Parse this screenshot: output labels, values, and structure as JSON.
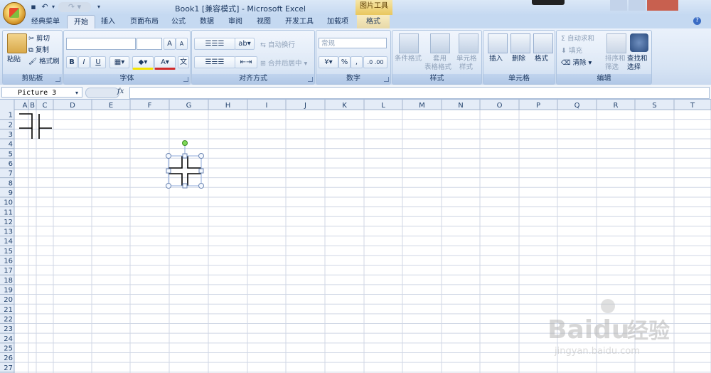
{
  "titlebar": {
    "document_title": "Book1  [兼容模式] - Microsoft Excel",
    "context_title": "图片工具"
  },
  "tabs": [
    "经典菜单",
    "开始",
    "插入",
    "页面布局",
    "公式",
    "数据",
    "审阅",
    "视图",
    "开发工具",
    "加载项",
    "格式"
  ],
  "active_tab": "开始",
  "ribbon": {
    "clipboard": {
      "paste": "粘贴",
      "cut": "剪切",
      "copy": "复制",
      "format_painter": "格式刷",
      "label": "剪贴板"
    },
    "font": {
      "label": "字体",
      "bold": "B",
      "italic": "I",
      "underline": "U",
      "grow": "A",
      "shrink": "A"
    },
    "alignment": {
      "wrap": "自动换行",
      "merge": "合并后居中",
      "label": "对齐方式"
    },
    "number": {
      "format": "常规",
      "percent": "%",
      "comma": ",",
      "label": "数字"
    },
    "styles": {
      "conditional": "条件格式",
      "table_line1": "套用",
      "table_line2": "表格格式",
      "cell_line1": "单元格",
      "cell_line2": "样式",
      "label": "样式"
    },
    "cells": {
      "insert": "插入",
      "delete": "删除",
      "format": "格式",
      "label": "单元格"
    },
    "editing": {
      "autosum": "自动求和",
      "fill": "填充",
      "clear": "清除",
      "sort_line1": "排序和",
      "sort_line2": "筛选",
      "find_line1": "查找和",
      "find_line2": "选择",
      "label": "编辑"
    }
  },
  "formula_bar": {
    "name_box": "Picture 3",
    "fx": "fx",
    "value": ""
  },
  "sheet": {
    "columns": [
      "A",
      "B",
      "C",
      "D",
      "E",
      "F",
      "G",
      "H",
      "I",
      "J",
      "K",
      "L",
      "M",
      "N",
      "O",
      "P",
      "Q",
      "R",
      "S",
      "T"
    ],
    "rows": [
      "1",
      "2",
      "3",
      "4",
      "5",
      "6",
      "7",
      "8",
      "9",
      "10",
      "11",
      "12",
      "13",
      "14",
      "15",
      "16",
      "17",
      "18",
      "19",
      "20",
      "21",
      "22",
      "23",
      "24",
      "25",
      "26",
      "27"
    ]
  },
  "watermark": {
    "brand": "Baidu",
    "brand_cn": "经验",
    "url": "jingyan.baidu.com"
  },
  "colors": {
    "ribbon": "#dbe6f4",
    "header": "#e4ecf7",
    "grid": "#d0d7e5",
    "accent": "#3a6cc4"
  }
}
